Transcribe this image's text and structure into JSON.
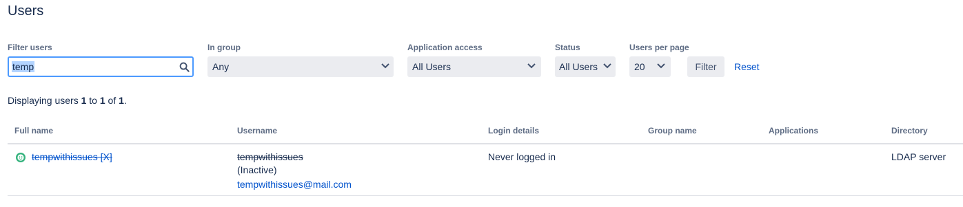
{
  "page": {
    "title": "Users"
  },
  "filters": {
    "filter_users": {
      "label": "Filter users",
      "value": "temp"
    },
    "in_group": {
      "label": "In group",
      "value": "Any"
    },
    "application_access": {
      "label": "Application access",
      "value": "All Users"
    },
    "status": {
      "label": "Status",
      "value": "All Users"
    },
    "users_per_page": {
      "label": "Users per page",
      "value": "20"
    },
    "filter_button": "Filter",
    "reset_link": "Reset"
  },
  "summary": {
    "prefix": "Displaying users ",
    "from": "1",
    "to_word": " to ",
    "to": "1",
    "of_word": " of ",
    "total": "1",
    "suffix": "."
  },
  "table": {
    "columns": [
      "Full name",
      "Username",
      "Login details",
      "Group name",
      "Applications",
      "Directory"
    ],
    "rows": [
      {
        "full_name": "tempwithissues [X]",
        "username": "tempwithissues",
        "username_status": "(Inactive)",
        "email": "tempwithissues@mail.com",
        "login_details": "Never logged in",
        "group_name": "",
        "applications": "",
        "directory": "LDAP server"
      }
    ]
  },
  "colors": {
    "link": "#0052cc",
    "focus": "#4c9aff",
    "selection": "#b3d4ff",
    "avatar": "#36b37e"
  }
}
